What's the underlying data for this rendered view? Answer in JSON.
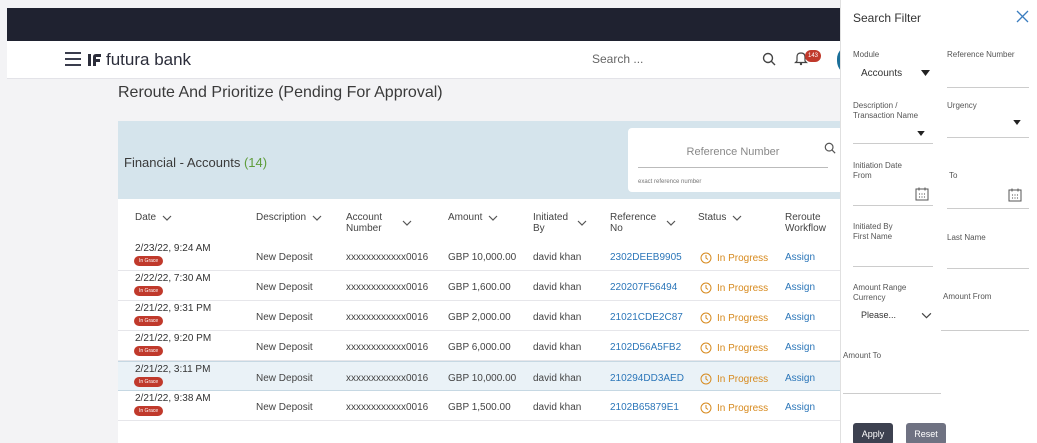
{
  "header": {
    "brand": "futura bank",
    "search_placeholder": "Search ...",
    "notification_count": "143"
  },
  "page": {
    "title": "Reroute And Prioritize (Pending For Approval)",
    "section_title": "Financial - Accounts",
    "section_count": "(14)",
    "ref_placeholder": "Reference Number",
    "ref_hint": "exact reference number"
  },
  "table": {
    "columns": [
      {
        "label": "Date"
      },
      {
        "label": "Description"
      },
      {
        "label1": "Account",
        "label2": "Number"
      },
      {
        "label": "Amount"
      },
      {
        "label1": "Initiated",
        "label2": "By"
      },
      {
        "label1": "Reference",
        "label2": "No"
      },
      {
        "label": "Status"
      },
      {
        "label1": "Reroute",
        "label2": "Workflow"
      }
    ],
    "rows": [
      {
        "date": "2/23/22, 9:24 AM",
        "grace": "In Grace",
        "description": "New Deposit",
        "account": "xxxxxxxxxxxx0016",
        "amount": "GBP 10,000.00",
        "initiated_by": "david khan",
        "reference": "2302DEEB9905",
        "status": "In Progress",
        "action": "Assign"
      },
      {
        "date": "2/22/22, 7:30 AM",
        "grace": "In Grace",
        "description": "New Deposit",
        "account": "xxxxxxxxxxxx0016",
        "amount": "GBP 1,600.00",
        "initiated_by": "david khan",
        "reference": "220207F56494",
        "status": "In Progress",
        "action": "Assign"
      },
      {
        "date": "2/21/22, 9:31 PM",
        "grace": "In Grace",
        "description": "New Deposit",
        "account": "xxxxxxxxxxxx0016",
        "amount": "GBP 2,000.00",
        "initiated_by": "david khan",
        "reference": "21021CDE2C87",
        "status": "In Progress",
        "action": "Assign"
      },
      {
        "date": "2/21/22, 9:20 PM",
        "grace": "In Grace",
        "description": "New Deposit",
        "account": "xxxxxxxxxxxx0016",
        "amount": "GBP 6,000.00",
        "initiated_by": "david khan",
        "reference": "2102D56A5FB2",
        "status": "In Progress",
        "action": "Assign"
      },
      {
        "date": "2/21/22, 3:11 PM",
        "grace": "In Grace",
        "description": "New Deposit",
        "account": "xxxxxxxxxxxx0016",
        "amount": "GBP 10,000.00",
        "initiated_by": "david khan",
        "reference": "210294DD3AED",
        "status": "In Progress",
        "action": "Assign"
      },
      {
        "date": "2/21/22, 9:38 AM",
        "grace": "In Grace",
        "description": "New Deposit",
        "account": "xxxxxxxxxxxx0016",
        "amount": "GBP 1,500.00",
        "initiated_by": "david khan",
        "reference": "2102B65879E1",
        "status": "In Progress",
        "action": "Assign"
      }
    ]
  },
  "filter": {
    "title": "Search Filter",
    "module_label": "Module",
    "module_value": "Accounts",
    "reference_label": "Reference Number",
    "description_label1": "Description /",
    "description_label2": "Transaction Name",
    "urgency_label": "Urgency",
    "init_from_label1": "Initiation Date",
    "init_from_label2": "From",
    "to_label": "To",
    "initiated_by_label1": "Initiated By",
    "initiated_by_label2": "First Name",
    "last_name_label": "Last Name",
    "amount_currency_label1": "Amount Range",
    "amount_currency_label2": "Currency",
    "currency_value": "Please...",
    "amount_from_label": "Amount From",
    "amount_to_label": "Amount To",
    "apply": "Apply",
    "reset": "Reset"
  },
  "colors": {
    "topbar": "#1f2230",
    "accent_blue": "#2b76b9",
    "status_orange": "#d78a1e",
    "grace_red": "#c0392b",
    "band": "#d5e4ec"
  }
}
